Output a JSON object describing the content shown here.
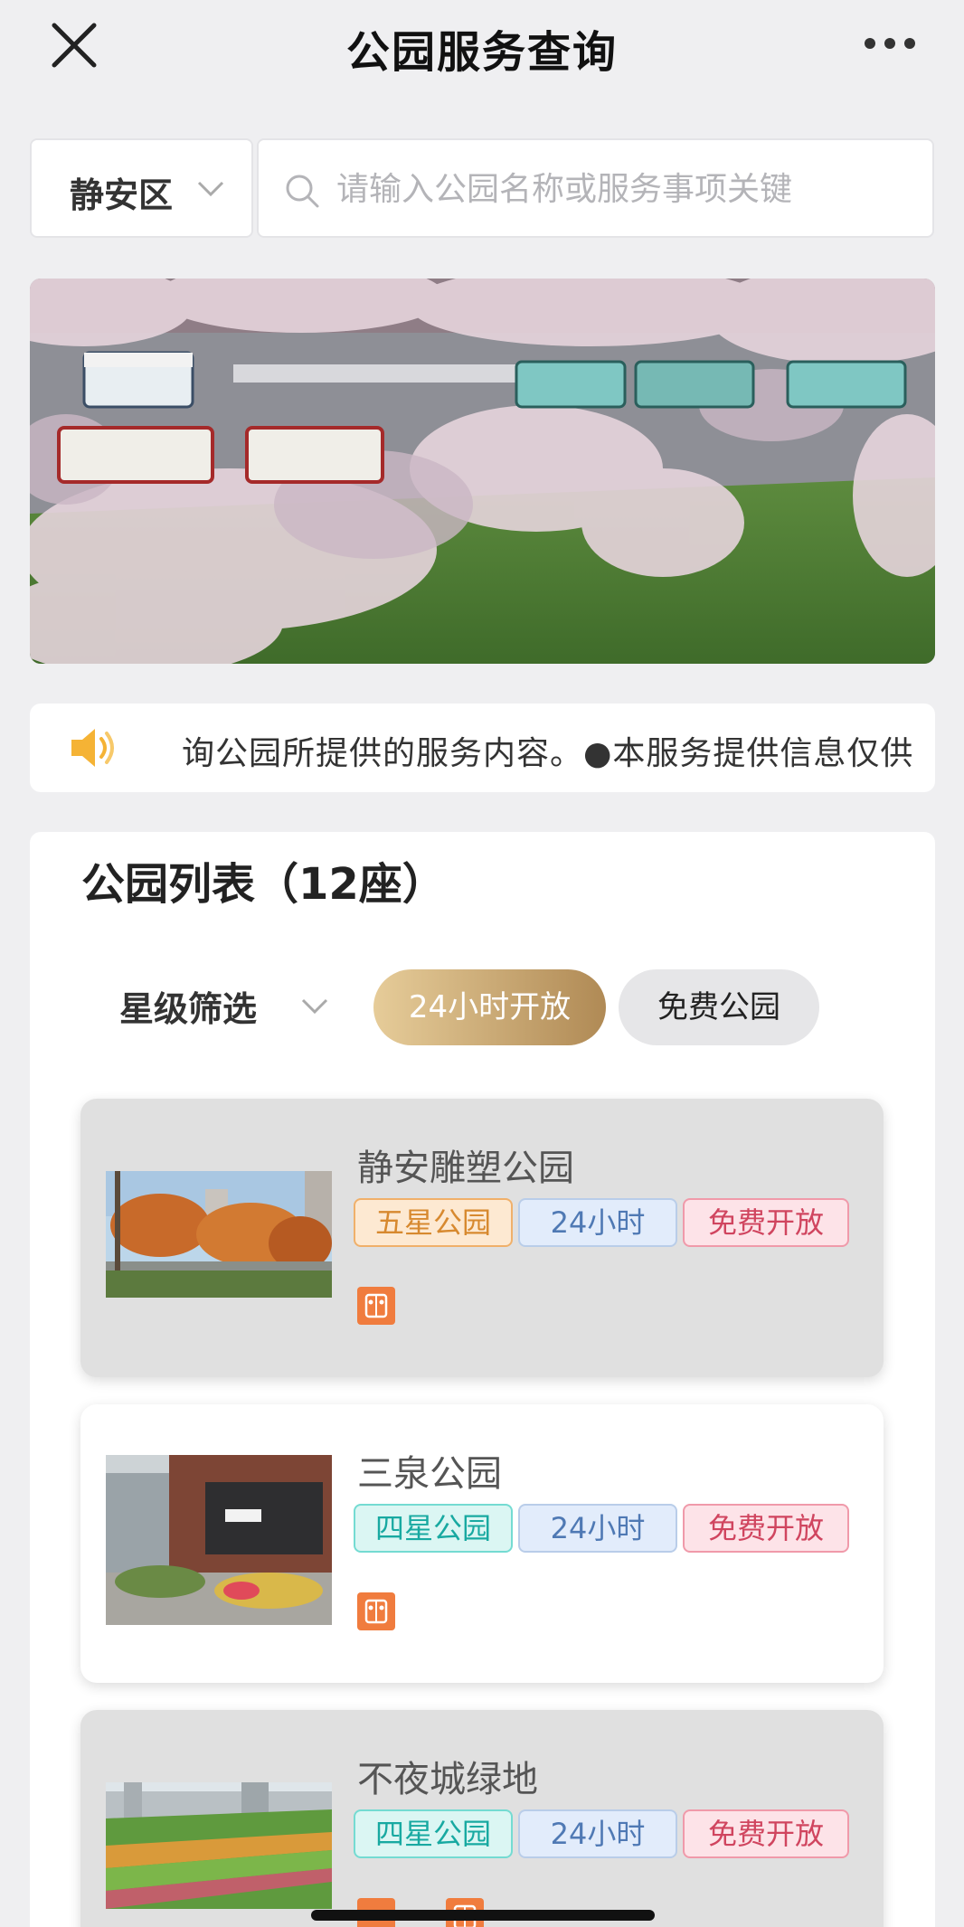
{
  "nav": {
    "title": "公园服务查询",
    "close_icon": "close-icon",
    "more_icon": "more-icon"
  },
  "search": {
    "district": "静安区",
    "placeholder": "请输入公园名称或服务事项关键"
  },
  "notice": {
    "icon": "speaker-icon",
    "text": "询公园所提供的服务内容。●本服务提供信息仅供"
  },
  "list": {
    "title": "公园列表（12座）",
    "star_filter_label": "星级筛选",
    "chips": {
      "open_24h": "24小时开放",
      "free": "免费公园"
    }
  },
  "parks": [
    {
      "name": "静安雕塑公园",
      "star": "五星公园",
      "hours": "24小时",
      "fee": "免费开放"
    },
    {
      "name": "三泉公园",
      "star": "四星公园",
      "hours": "24小时",
      "fee": "免费开放"
    },
    {
      "name": "不夜城绿地",
      "star": "四星公园",
      "hours": "24小时",
      "fee": "免费开放"
    }
  ],
  "colors": {
    "accent_gold": "#c9a66b",
    "tag_five_star": "#d7892f",
    "tag_four_star": "#18a9a1",
    "tag_hours": "#4f79b4",
    "tag_free": "#d0455f",
    "service_icon": "#f07c3e"
  }
}
